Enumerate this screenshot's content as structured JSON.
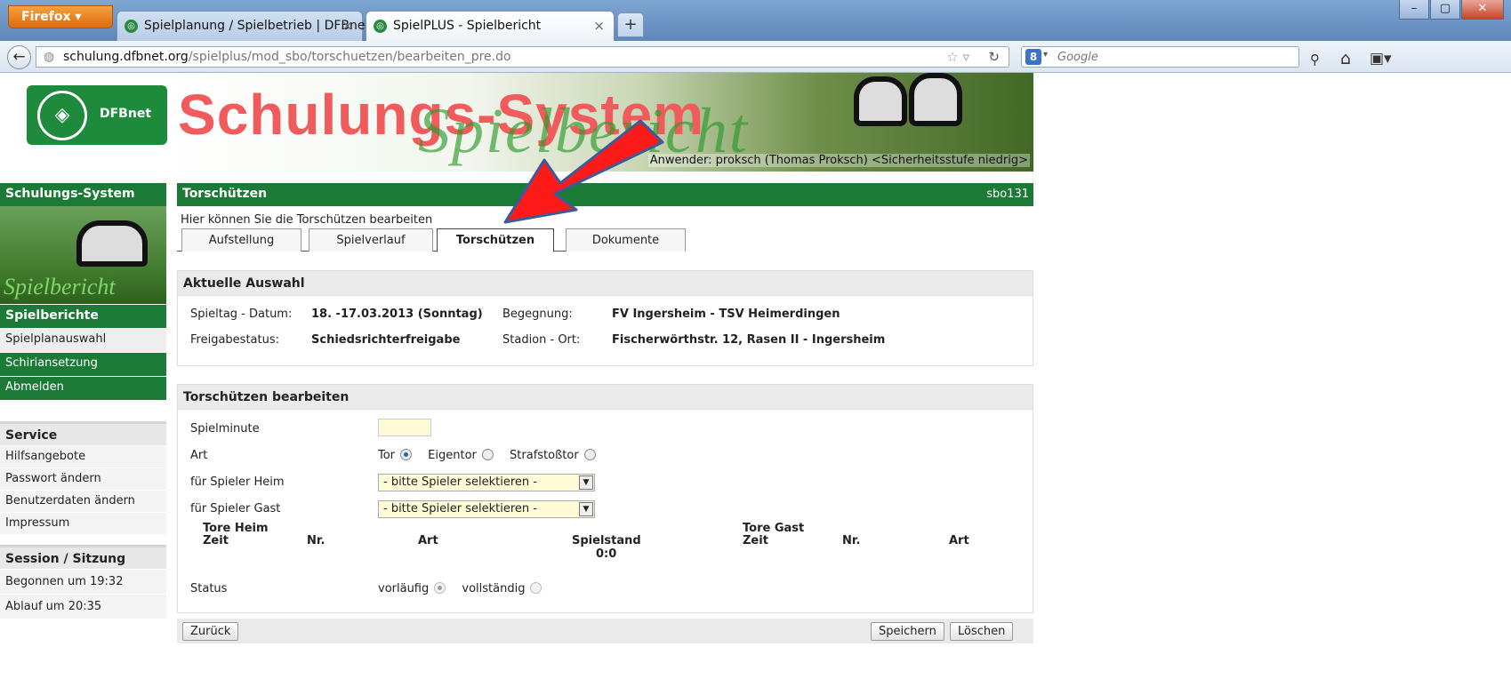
{
  "browser": {
    "menu_button": "Firefox",
    "tabs": [
      {
        "title": "Spielplanung / Spielbetrieb | DFBnet"
      },
      {
        "title": "SpielPLUS - Spielbericht"
      }
    ],
    "url_host": "schulung.dfbnet.org",
    "url_path": "/spielplus/mod_sbo/torschuetzen/bearbeiten_pre.do",
    "search_placeholder": "Google"
  },
  "banner": {
    "logo_text": "DFBnet",
    "title_red": "Schulungs-System",
    "title_green": "Spielbericht",
    "user_line": "Anwender: proksch (Thomas Proksch) <Sicherheitsstufe niedrig>"
  },
  "sidebar": {
    "header": "Schulungs-System",
    "image_text": "Spielbericht",
    "nav_header": "Spielberichte",
    "nav_items": [
      "Spielplanauswahl",
      "Schiriansetzung",
      "Abmelden"
    ],
    "service": {
      "header": "Service",
      "items": [
        "Hilfsangebote",
        "Passwort ändern",
        "Benutzerdaten ändern",
        "Impressum"
      ]
    },
    "session": {
      "header": "Session / Sitzung",
      "items": [
        "Begonnen um 19:32",
        "Ablauf um 20:35"
      ]
    }
  },
  "main": {
    "title": "Torschützen",
    "code": "sbo131",
    "description": "Hier können Sie die Torschützen bearbeiten",
    "tabs": [
      "Aufstellung",
      "Spielverlauf",
      "Torschützen",
      "Dokumente"
    ],
    "active_tab": "Torschützen",
    "auswahl": {
      "header": "Aktuelle Auswahl",
      "spieltag_label": "Spieltag - Datum:",
      "spieltag_value": "18. -17.03.2013 (Sonntag)",
      "begegnung_label": "Begegnung:",
      "begegnung_value": "FV Ingersheim - TSV Heimerdingen",
      "freigabe_label": "Freigabestatus:",
      "freigabe_value": "Schiedsrichterfreigabe",
      "stadion_label": "Stadion - Ort:",
      "stadion_value": "Fischerwörthstr. 12, Rasen II - Ingersheim"
    },
    "edit": {
      "header": "Torschützen bearbeiten",
      "minute_label": "Spielminute",
      "art_label": "Art",
      "art_options": [
        "Tor",
        "Eigentor",
        "Strafstoßtor"
      ],
      "art_selected": "Tor",
      "heim_label": "für Spieler Heim",
      "heim_value": "- bitte Spieler selektieren -",
      "gast_label": "für Spieler Gast",
      "gast_value": "- bitte Spieler selektieren -",
      "tore_heim": "Tore Heim",
      "tore_gast": "Tore Gast",
      "col_zeit": "Zeit",
      "col_nr": "Nr.",
      "col_art": "Art",
      "col_spielstand": "Spielstand",
      "spielstand": "0:0",
      "status_label": "Status",
      "status_options": [
        "vorläufig",
        "vollständig"
      ],
      "status_selected": "vorläufig"
    },
    "buttons": {
      "back": "Zurück",
      "save": "Speichern",
      "delete": "Löschen"
    }
  },
  "colors": {
    "dfb_green": "#1b7a35",
    "arrow_red": "#ff1a1a",
    "input_yellow": "#fffbd6"
  }
}
